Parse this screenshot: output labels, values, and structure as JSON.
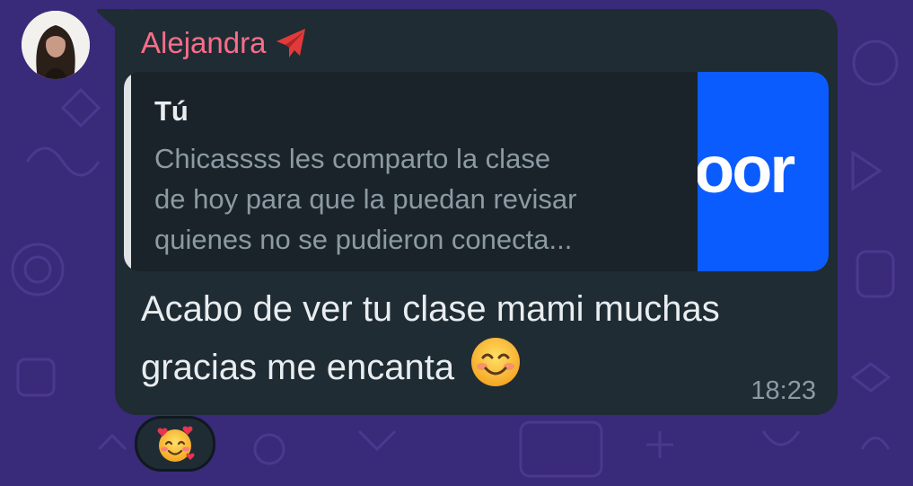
{
  "chat": {
    "sender_name": "Alejandra",
    "sender_emoji": "airplane-icon",
    "quoted_author": "Tú",
    "quoted_text": "Chicassss les comparto la clase\nde hoy para que la puedan revisar\nquienes no se pudieron conecta...",
    "quoted_thumb_text": "oor",
    "message_text": "Acabo de ver tu clase mami muchas gracias me encanta",
    "message_emoji": "smiling-face-icon",
    "time": "18:23",
    "reaction_emoji": "smiling-face-with-hearts-icon"
  },
  "colors": {
    "wallpaper": "#3a2a7a",
    "bubble": "#1f2c34",
    "sender": "#fa6d88",
    "zoom_blue": "#0b5cff"
  }
}
